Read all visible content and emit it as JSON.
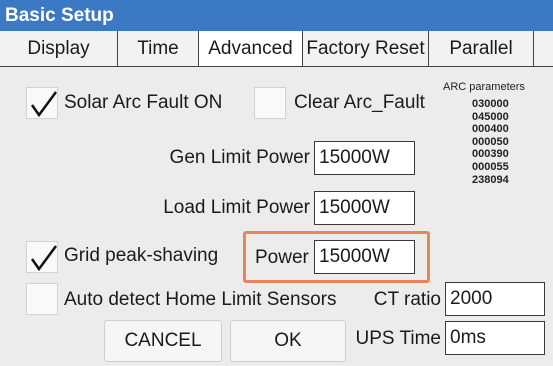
{
  "window": {
    "title": "Basic Setup"
  },
  "tabs": [
    {
      "label": "Display"
    },
    {
      "label": "Time"
    },
    {
      "label": "Advanced",
      "active": true
    },
    {
      "label": "Factory Reset"
    },
    {
      "label": "Parallel"
    }
  ],
  "arc": {
    "solar_arc_fault_label": "Solar Arc Fault ON",
    "solar_arc_fault_checked": true,
    "clear_arc_fault_label": "Clear Arc_Fault",
    "clear_arc_fault_checked": false,
    "parameters_title": "ARC parameters",
    "parameters": [
      "030000",
      "045000",
      "000400",
      "000050",
      "000390",
      "000055",
      "238094"
    ]
  },
  "limits": {
    "gen_limit_label": "Gen Limit Power",
    "gen_limit_value": "15000W",
    "load_limit_label": "Load Limit Power",
    "load_limit_value": "15000W"
  },
  "peak_shaving": {
    "label": "Grid peak-shaving",
    "checked": true,
    "power_label": "Power",
    "power_value": "15000W"
  },
  "sensors": {
    "auto_detect_label": "Auto detect Home Limit Sensors",
    "auto_detect_checked": false,
    "ct_ratio_label": "CT ratio",
    "ct_ratio_value": "2000",
    "ups_time_label": "UPS Time",
    "ups_time_value": "0ms"
  },
  "buttons": {
    "cancel": "CANCEL",
    "ok": "OK"
  },
  "colors": {
    "titlebar": "#3b79c4",
    "highlight": "#e8865a",
    "background": "#ececec"
  }
}
